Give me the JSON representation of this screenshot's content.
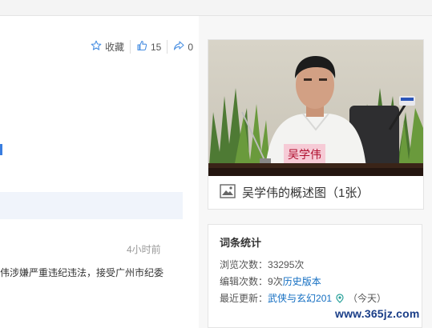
{
  "actions": {
    "favorite_label": "收藏",
    "like_count": "15",
    "share_count": "0"
  },
  "news": {
    "time": "4小时前",
    "text": "伟涉嫌严重违纪违法，接受广州市纪委"
  },
  "photo": {
    "nameplate": "吴学伟",
    "caption": "吴学伟的概述图（1张）"
  },
  "stats": {
    "title": "词条统计",
    "views_label": "浏览次数：",
    "views_value": "33295次",
    "edits_label": "编辑次数：",
    "edits_value": "9次",
    "history_link": "历史版本",
    "updated_label": "最近更新：",
    "updated_user": "武侠与玄幻201",
    "updated_when": "（今天）"
  },
  "watermark": "www.365jz.com"
}
